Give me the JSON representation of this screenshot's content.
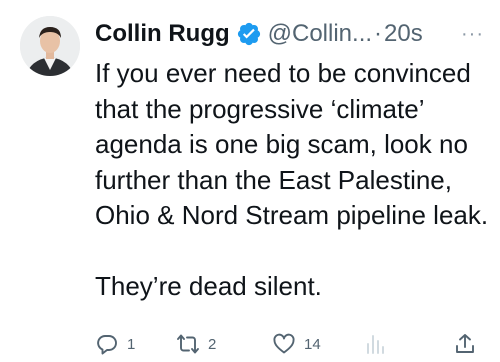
{
  "tweet": {
    "author_name": "Collin Rugg",
    "handle": "@Collin...",
    "separator": "·",
    "time": "20s",
    "more_label": "···",
    "text_lines": [
      "If you ever need to be convinced that the progressive ‘climate’ agenda is one big scam, look no further than the East Palestine, Ohio & Nord Stream pipeline leak.",
      "They’re dead silent."
    ],
    "verified_color": "#1d9bf0"
  },
  "actions": {
    "reply_count": "1",
    "retweet_count": "2",
    "like_count": "14",
    "icons": [
      "reply-icon",
      "retweet-icon",
      "like-icon",
      "views-icon",
      "share-icon"
    ]
  }
}
